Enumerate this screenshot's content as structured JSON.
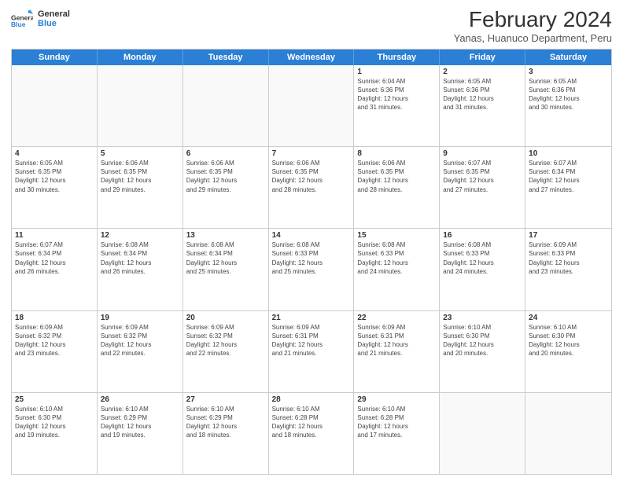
{
  "logo": {
    "line1": "General",
    "line2": "Blue"
  },
  "title": "February 2024",
  "subtitle": "Yanas, Huanuco Department, Peru",
  "days": [
    "Sunday",
    "Monday",
    "Tuesday",
    "Wednesday",
    "Thursday",
    "Friday",
    "Saturday"
  ],
  "weeks": [
    [
      {
        "day": "",
        "info": ""
      },
      {
        "day": "",
        "info": ""
      },
      {
        "day": "",
        "info": ""
      },
      {
        "day": "",
        "info": ""
      },
      {
        "day": "1",
        "info": "Sunrise: 6:04 AM\nSunset: 6:36 PM\nDaylight: 12 hours\nand 31 minutes."
      },
      {
        "day": "2",
        "info": "Sunrise: 6:05 AM\nSunset: 6:36 PM\nDaylight: 12 hours\nand 31 minutes."
      },
      {
        "day": "3",
        "info": "Sunrise: 6:05 AM\nSunset: 6:36 PM\nDaylight: 12 hours\nand 30 minutes."
      }
    ],
    [
      {
        "day": "4",
        "info": "Sunrise: 6:05 AM\nSunset: 6:35 PM\nDaylight: 12 hours\nand 30 minutes."
      },
      {
        "day": "5",
        "info": "Sunrise: 6:06 AM\nSunset: 6:35 PM\nDaylight: 12 hours\nand 29 minutes."
      },
      {
        "day": "6",
        "info": "Sunrise: 6:06 AM\nSunset: 6:35 PM\nDaylight: 12 hours\nand 29 minutes."
      },
      {
        "day": "7",
        "info": "Sunrise: 6:06 AM\nSunset: 6:35 PM\nDaylight: 12 hours\nand 28 minutes."
      },
      {
        "day": "8",
        "info": "Sunrise: 6:06 AM\nSunset: 6:35 PM\nDaylight: 12 hours\nand 28 minutes."
      },
      {
        "day": "9",
        "info": "Sunrise: 6:07 AM\nSunset: 6:35 PM\nDaylight: 12 hours\nand 27 minutes."
      },
      {
        "day": "10",
        "info": "Sunrise: 6:07 AM\nSunset: 6:34 PM\nDaylight: 12 hours\nand 27 minutes."
      }
    ],
    [
      {
        "day": "11",
        "info": "Sunrise: 6:07 AM\nSunset: 6:34 PM\nDaylight: 12 hours\nand 26 minutes."
      },
      {
        "day": "12",
        "info": "Sunrise: 6:08 AM\nSunset: 6:34 PM\nDaylight: 12 hours\nand 26 minutes."
      },
      {
        "day": "13",
        "info": "Sunrise: 6:08 AM\nSunset: 6:34 PM\nDaylight: 12 hours\nand 25 minutes."
      },
      {
        "day": "14",
        "info": "Sunrise: 6:08 AM\nSunset: 6:33 PM\nDaylight: 12 hours\nand 25 minutes."
      },
      {
        "day": "15",
        "info": "Sunrise: 6:08 AM\nSunset: 6:33 PM\nDaylight: 12 hours\nand 24 minutes."
      },
      {
        "day": "16",
        "info": "Sunrise: 6:08 AM\nSunset: 6:33 PM\nDaylight: 12 hours\nand 24 minutes."
      },
      {
        "day": "17",
        "info": "Sunrise: 6:09 AM\nSunset: 6:33 PM\nDaylight: 12 hours\nand 23 minutes."
      }
    ],
    [
      {
        "day": "18",
        "info": "Sunrise: 6:09 AM\nSunset: 6:32 PM\nDaylight: 12 hours\nand 23 minutes."
      },
      {
        "day": "19",
        "info": "Sunrise: 6:09 AM\nSunset: 6:32 PM\nDaylight: 12 hours\nand 22 minutes."
      },
      {
        "day": "20",
        "info": "Sunrise: 6:09 AM\nSunset: 6:32 PM\nDaylight: 12 hours\nand 22 minutes."
      },
      {
        "day": "21",
        "info": "Sunrise: 6:09 AM\nSunset: 6:31 PM\nDaylight: 12 hours\nand 21 minutes."
      },
      {
        "day": "22",
        "info": "Sunrise: 6:09 AM\nSunset: 6:31 PM\nDaylight: 12 hours\nand 21 minutes."
      },
      {
        "day": "23",
        "info": "Sunrise: 6:10 AM\nSunset: 6:30 PM\nDaylight: 12 hours\nand 20 minutes."
      },
      {
        "day": "24",
        "info": "Sunrise: 6:10 AM\nSunset: 6:30 PM\nDaylight: 12 hours\nand 20 minutes."
      }
    ],
    [
      {
        "day": "25",
        "info": "Sunrise: 6:10 AM\nSunset: 6:30 PM\nDaylight: 12 hours\nand 19 minutes."
      },
      {
        "day": "26",
        "info": "Sunrise: 6:10 AM\nSunset: 6:29 PM\nDaylight: 12 hours\nand 19 minutes."
      },
      {
        "day": "27",
        "info": "Sunrise: 6:10 AM\nSunset: 6:29 PM\nDaylight: 12 hours\nand 18 minutes."
      },
      {
        "day": "28",
        "info": "Sunrise: 6:10 AM\nSunset: 6:28 PM\nDaylight: 12 hours\nand 18 minutes."
      },
      {
        "day": "29",
        "info": "Sunrise: 6:10 AM\nSunset: 6:28 PM\nDaylight: 12 hours\nand 17 minutes."
      },
      {
        "day": "",
        "info": ""
      },
      {
        "day": "",
        "info": ""
      }
    ]
  ]
}
